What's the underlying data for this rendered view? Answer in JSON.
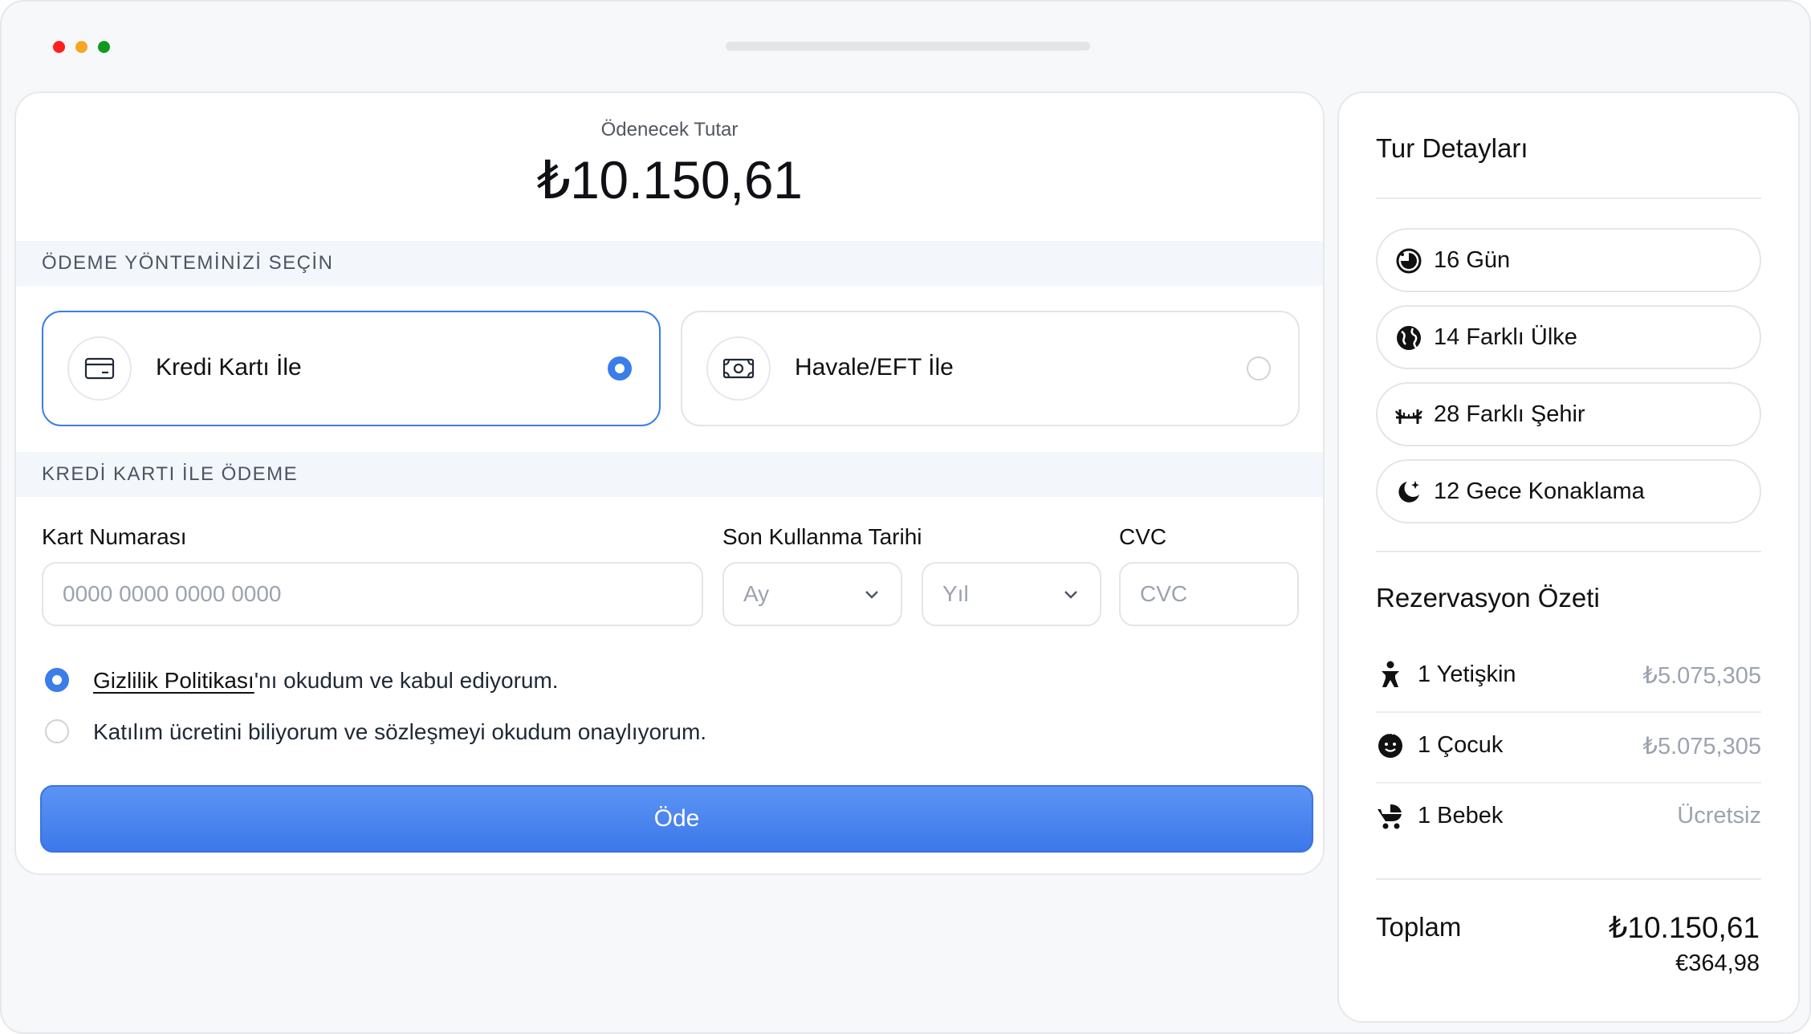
{
  "payment": {
    "amount_label": "Ödenecek Tutar",
    "amount": "₺10.150,61",
    "method_section_title": "ÖDEME YÖNTEMİNİZİ SEÇİN",
    "methods": [
      {
        "label": "Kredi Kartı İle",
        "icon": "credit-card-icon",
        "selected": true
      },
      {
        "label": "Havale/EFT İle",
        "icon": "banknote-icon",
        "selected": false
      }
    ],
    "card_section_title": "KREDİ KARTI İLE ÖDEME",
    "card_number_label": "Kart Numarası",
    "card_number_placeholder": "0000 0000 0000 0000",
    "expiry_label": "Son Kullanma Tarihi",
    "month_placeholder": "Ay",
    "year_placeholder": "Yıl",
    "cvc_label": "CVC",
    "cvc_placeholder": "CVC",
    "consent_privacy_link": "Gizlilik Politikası",
    "consent_privacy_rest": "'nı okudum ve kabul ediyorum.",
    "consent_privacy_checked": true,
    "consent_terms": "Katılım ücretini biliyorum ve sözleşmeyi okudum onaylıyorum.",
    "consent_terms_checked": false,
    "pay_button": "Öde"
  },
  "tour": {
    "title": "Tur Detayları",
    "details": [
      {
        "text": "16 Gün",
        "icon": "clock-icon"
      },
      {
        "text": "14 Farklı Ülke",
        "icon": "globe-icon"
      },
      {
        "text": "28 Farklı Şehir",
        "icon": "bridge-icon"
      },
      {
        "text": "12 Gece Konaklama",
        "icon": "moon-stars-icon"
      }
    ]
  },
  "summary": {
    "title": "Rezervasyon Özeti",
    "rows": [
      {
        "label": "1 Yetişkin",
        "price": "₺5.075,305",
        "icon": "adult-icon"
      },
      {
        "label": "1 Çocuk",
        "price": "₺5.075,305",
        "icon": "child-face-icon"
      },
      {
        "label": "1 Bebek",
        "price": "Ücretsiz",
        "icon": "stroller-icon"
      }
    ],
    "total_label": "Toplam",
    "total_try": "₺10.150,61",
    "total_eur": "€364,98"
  },
  "colors": {
    "accent": "#3b7de9",
    "button": "#4a86ee",
    "section_bg": "#f3f6fb"
  }
}
